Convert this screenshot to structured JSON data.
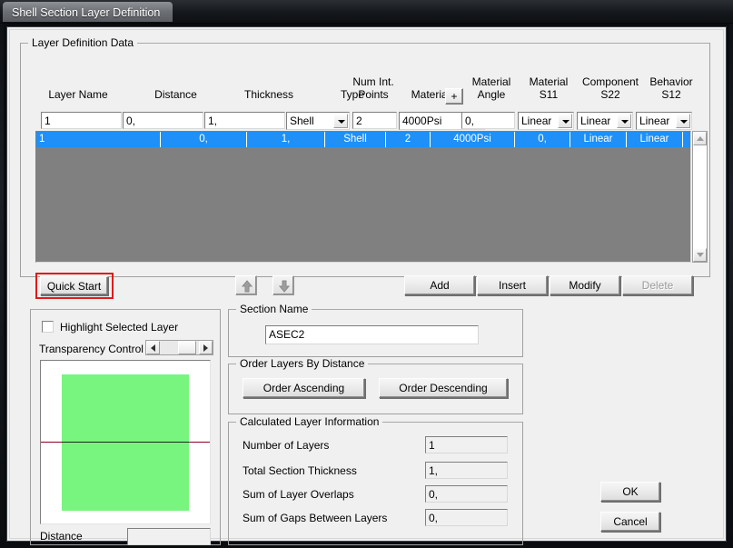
{
  "window": {
    "title": "Shell Section Layer Definition"
  },
  "layer_definition_data": {
    "legend": "Layer Definition Data",
    "columns": [
      {
        "header_top": "",
        "header_bottom": "Layer Name"
      },
      {
        "header_top": "",
        "header_bottom": "Distance"
      },
      {
        "header_top": "",
        "header_bottom": "Thickness"
      },
      {
        "header_top": "",
        "header_bottom": "Type"
      },
      {
        "header_top": "Num Int.",
        "header_bottom": "Points"
      },
      {
        "header_top": "",
        "header_bottom": "Material"
      },
      {
        "header_top": "Material",
        "header_bottom": "Angle"
      },
      {
        "header_top": "Material",
        "header_bottom": "S11"
      },
      {
        "header_top": "Component",
        "header_bottom": "S22"
      },
      {
        "header_top": "Behavior",
        "header_bottom": "S12"
      }
    ],
    "add_material_button": "+",
    "inputs": {
      "layer_name": "1",
      "distance": "0,",
      "thickness": "1,",
      "type": "Shell",
      "num_int_points": "2",
      "material": "4000Psi",
      "material_angle": "0,",
      "material_s11": "Linear",
      "component_s22": "Linear",
      "behavior_s12": "Linear"
    },
    "rows": [
      {
        "layer_name": "1",
        "distance": "0,",
        "thickness": "1,",
        "type": "Shell",
        "num_int_points": "2",
        "material": "4000Psi",
        "material_angle": "0,",
        "material_s11": "Linear",
        "component_s22": "Linear",
        "behavior_s12": "Linear",
        "selected": true
      }
    ],
    "buttons": {
      "quick_start": "Quick Start",
      "move_up": "move-up",
      "move_down": "move-down",
      "add": "Add",
      "insert": "Insert",
      "modify": "Modify",
      "delete": "Delete"
    },
    "delete_enabled": false,
    "highlight_color": "#e01b1b"
  },
  "preview_panel": {
    "highlight_selected_layer_label": "Highlight Selected Layer",
    "highlight_selected_layer_checked": false,
    "transparency_control_label": "Transparency Control",
    "distance_label": "Distance",
    "distance_value": "",
    "slab_color": "#78f57e",
    "axis_color": "#8b0020"
  },
  "section_name": {
    "legend": "Section Name",
    "value": "ASEC2"
  },
  "order_layers": {
    "legend": "Order Layers By Distance",
    "order_ascending": "Order Ascending",
    "order_descending": "Order Descending"
  },
  "calculated_layer_information": {
    "legend": "Calculated Layer Information",
    "rows": [
      {
        "label": "Number of Layers",
        "value": "1"
      },
      {
        "label": "Total Section Thickness",
        "value": "1,"
      },
      {
        "label": "Sum of Layer Overlaps",
        "value": "0,"
      },
      {
        "label": "Sum of Gaps Between Layers",
        "value": "0,"
      }
    ]
  },
  "dialog_buttons": {
    "ok": "OK",
    "cancel": "Cancel"
  }
}
